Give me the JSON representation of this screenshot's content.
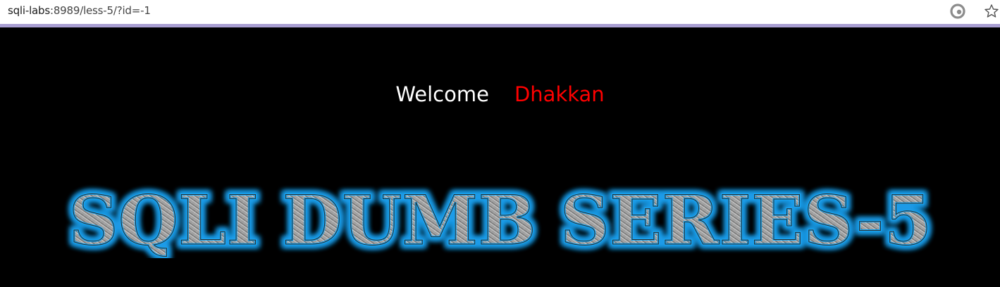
{
  "browser": {
    "url_host": "sqli-labs",
    "url_rest": ":8989/less-5/?id=-1",
    "icons": {
      "refresh": "edge-refresh-icon",
      "favorite": "star-icon"
    }
  },
  "page": {
    "welcome_label": "Welcome",
    "welcome_name": "Dhakkan",
    "banner_text": "SQLI DUMB SERIES-5",
    "colors": {
      "background": "#000000",
      "welcome": "#ffffff",
      "name": "#ff0000",
      "banner_glow": "#1e9be8",
      "banner_metal": "#9a9a9a"
    }
  }
}
